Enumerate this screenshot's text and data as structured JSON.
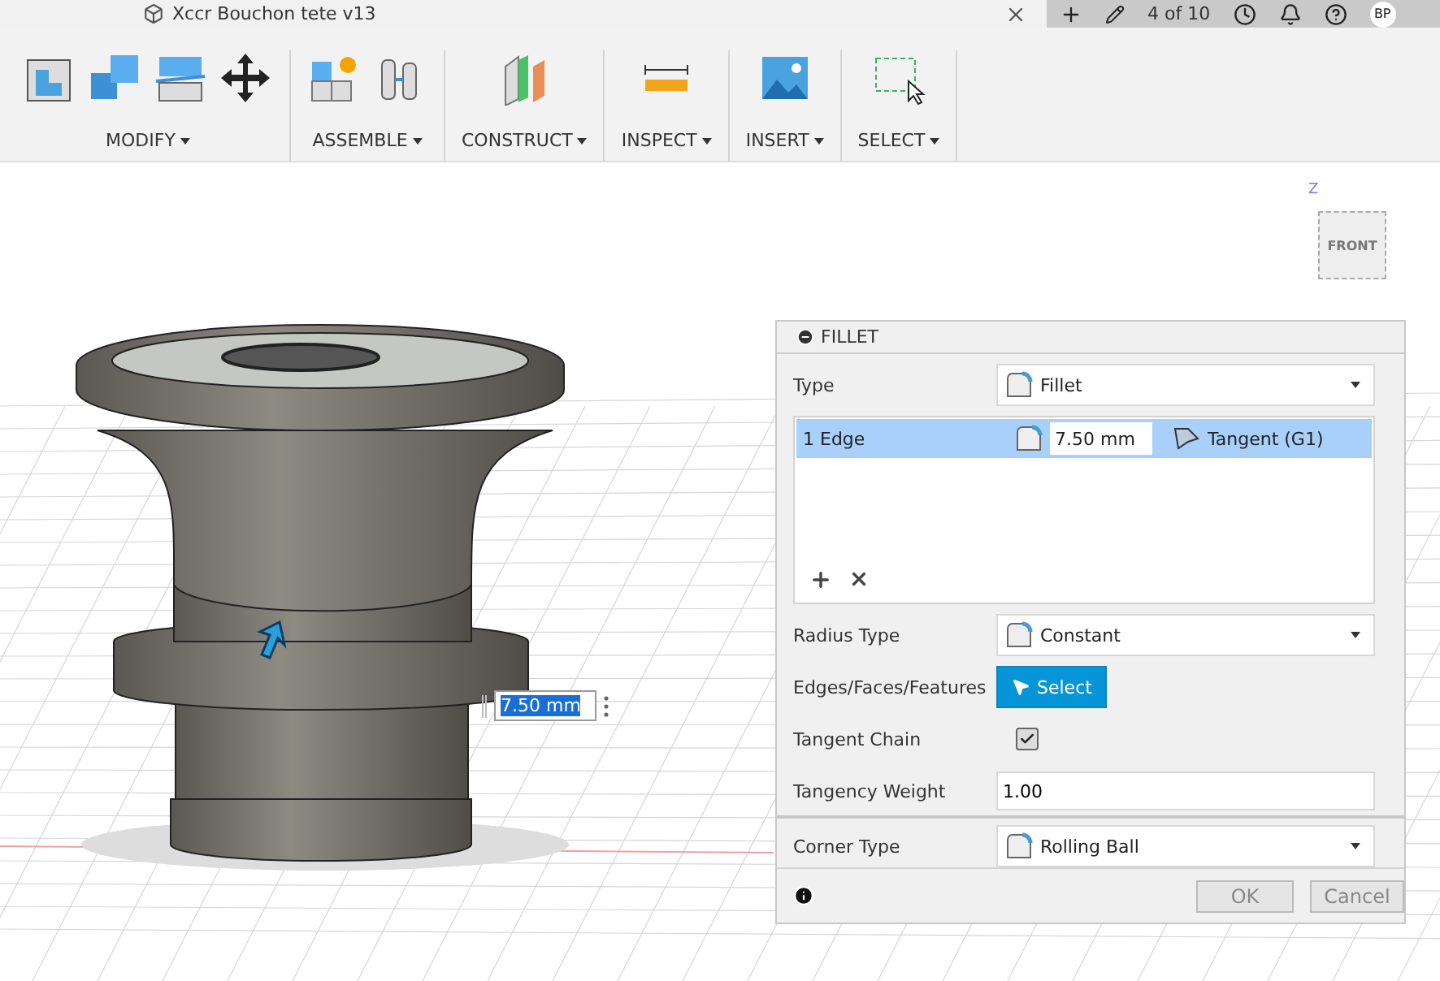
{
  "document_tab": {
    "title": "Xccr Bouchon tete v13"
  },
  "top_bar": {
    "version": "4 of 10",
    "user_initials": "BP"
  },
  "toolbar": {
    "groups": [
      {
        "label": "MODIFY",
        "tools": [
          {
            "kind": "press_pull"
          },
          {
            "kind": "combine"
          },
          {
            "kind": "split"
          },
          {
            "kind": "move"
          }
        ]
      },
      {
        "label": "ASSEMBLE",
        "tools": [
          {
            "kind": "new_component"
          },
          {
            "kind": "joint"
          }
        ]
      },
      {
        "label": "CONSTRUCT",
        "tools": [
          {
            "kind": "plane"
          }
        ]
      },
      {
        "label": "INSPECT",
        "tools": [
          {
            "kind": "measure"
          }
        ]
      },
      {
        "label": "INSERT",
        "tools": [
          {
            "kind": "image"
          }
        ]
      },
      {
        "label": "SELECT",
        "tools": [
          {
            "kind": "window_select"
          }
        ]
      }
    ]
  },
  "viewcube": {
    "face": "FRONT",
    "axis": "Z"
  },
  "dimension_input": {
    "value": "7.50 mm",
    "selected": true
  },
  "fillet_dialog": {
    "title": "FILLET",
    "fields": [
      {
        "kind": "dropdown",
        "label": "Type",
        "value": "Fillet"
      },
      {
        "kind": "edge_list",
        "rows": [
          {
            "label": "1 Edge",
            "radius": "7.50 mm",
            "continuity": "Tangent (G1)",
            "selected": true
          }
        ]
      },
      {
        "kind": "dropdown",
        "label": "Radius Type",
        "value": "Constant"
      },
      {
        "kind": "button",
        "label": "Edges/Faces/Features",
        "value": "Select"
      },
      {
        "kind": "checkbox",
        "label": "Tangent Chain",
        "checked": true
      },
      {
        "kind": "input",
        "label": "Tangency Weight",
        "value": "1.00"
      }
    ],
    "corner_field": {
      "kind": "dropdown",
      "label": "Corner Type",
      "value": "Rolling Ball"
    },
    "buttons": [
      "OK",
      "Cancel"
    ]
  }
}
